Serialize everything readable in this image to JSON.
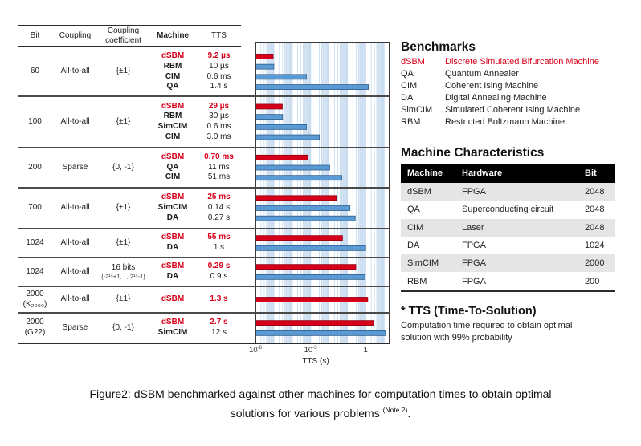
{
  "colors": {
    "dsbm": "#d7001a",
    "dsbm_border": "#8e0010",
    "other": "#5b9bd5",
    "other_border": "#2f5b8a",
    "grid_line": "#c6dbef",
    "grid_band": "#dbe8f5"
  },
  "left_table": {
    "headers": {
      "bit": "Bit",
      "coupling": "Coupling",
      "coefficient": [
        "Coupling",
        "coefficient"
      ],
      "machine": "Machine",
      "tts": "TTS"
    },
    "rows": [
      {
        "bit": [
          "60"
        ],
        "coupling": "All-to-all",
        "coefficient": [
          "{±1}"
        ],
        "entries": [
          {
            "machine": "dSBM",
            "tts": "9.2 µs",
            "highlight": true
          },
          {
            "machine": "RBM",
            "tts": "10 µs",
            "highlight": false
          },
          {
            "machine": "CIM",
            "tts": "0.6 ms",
            "highlight": false
          },
          {
            "machine": "QA",
            "tts": "1.4 s",
            "highlight": false
          }
        ]
      },
      {
        "bit": [
          "100"
        ],
        "coupling": "All-to-all",
        "coefficient": [
          "{±1}"
        ],
        "entries": [
          {
            "machine": "dSBM",
            "tts": "29 µs",
            "highlight": true
          },
          {
            "machine": "RBM",
            "tts": "30 µs",
            "highlight": false
          },
          {
            "machine": "SimCIM",
            "tts": "0.6 ms",
            "highlight": false
          },
          {
            "machine": "CIM",
            "tts": "3.0 ms",
            "highlight": false
          }
        ]
      },
      {
        "bit": [
          "200"
        ],
        "coupling": "Sparse",
        "coefficient": [
          "{0, -1}"
        ],
        "entries": [
          {
            "machine": "dSBM",
            "tts": "0.70 ms",
            "highlight": true
          },
          {
            "machine": "QA",
            "tts": "11 ms",
            "highlight": false
          },
          {
            "machine": "CIM",
            "tts": "51 ms",
            "highlight": false
          }
        ]
      },
      {
        "bit": [
          "700"
        ],
        "coupling": "All-to-all",
        "coefficient": [
          "{±1}"
        ],
        "entries": [
          {
            "machine": "dSBM",
            "tts": "25 ms",
            "highlight": true
          },
          {
            "machine": "SimCIM",
            "tts": "0.14 s",
            "highlight": false
          },
          {
            "machine": "DA",
            "tts": "0.27 s",
            "highlight": false
          }
        ]
      },
      {
        "bit": [
          "1024"
        ],
        "coupling": "All-to-all",
        "coefficient": [
          "{±1}"
        ],
        "entries": [
          {
            "machine": "dSBM",
            "tts": "55 ms",
            "highlight": true
          },
          {
            "machine": "DA",
            "tts": "1 s",
            "highlight": false
          }
        ]
      },
      {
        "bit": [
          "1024"
        ],
        "coupling": "All-to-all",
        "coefficient": [
          "16 bits",
          "{-2¹⁵+1,..., 2¹⁵-1}"
        ],
        "entries": [
          {
            "machine": "dSBM",
            "tts": "0.29 s",
            "highlight": true
          },
          {
            "machine": "DA",
            "tts": "0.9 s",
            "highlight": false
          }
        ]
      },
      {
        "bit": [
          "2000",
          "(K₂₀₀₀)"
        ],
        "coupling": "All-to-all",
        "coefficient": [
          "{±1}"
        ],
        "entries": [
          {
            "machine": "dSBM",
            "tts": "1.3 s",
            "highlight": true
          }
        ]
      },
      {
        "bit": [
          "2000",
          "(G22)"
        ],
        "coupling": "Sparse",
        "coefficient": [
          "{0, -1}"
        ],
        "entries": [
          {
            "machine": "dSBM",
            "tts": "2.7 s",
            "highlight": true
          },
          {
            "machine": "SimCIM",
            "tts": "12 s",
            "highlight": false
          }
        ]
      }
    ]
  },
  "chart_data": {
    "type": "bar",
    "orientation": "horizontal",
    "xscale": "log",
    "xlabel": "TTS (s)",
    "ylabel": "",
    "xlim": [
      1e-06,
      20
    ],
    "grid": true,
    "xticks": [
      {
        "value": 1e-06,
        "base": "10",
        "exp": "-6"
      },
      {
        "value": 0.001,
        "base": "10",
        "exp": "-3"
      },
      {
        "value": 1,
        "base": "1",
        "exp": ""
      }
    ],
    "groups": [
      {
        "bit": "60",
        "bars": [
          {
            "machine": "dSBM",
            "value": 9.2e-06
          },
          {
            "machine": "RBM",
            "value": 1e-05
          },
          {
            "machine": "CIM",
            "value": 0.0006
          },
          {
            "machine": "QA",
            "value": 1.4
          }
        ]
      },
      {
        "bit": "100",
        "bars": [
          {
            "machine": "dSBM",
            "value": 2.9e-05
          },
          {
            "machine": "RBM",
            "value": 3e-05
          },
          {
            "machine": "SimCIM",
            "value": 0.0006
          },
          {
            "machine": "CIM",
            "value": 0.003
          }
        ]
      },
      {
        "bit": "200",
        "bars": [
          {
            "machine": "dSBM",
            "value": 0.0007
          },
          {
            "machine": "QA",
            "value": 0.011
          },
          {
            "machine": "CIM",
            "value": 0.051
          }
        ]
      },
      {
        "bit": "700",
        "bars": [
          {
            "machine": "dSBM",
            "value": 0.025
          },
          {
            "machine": "SimCIM",
            "value": 0.14
          },
          {
            "machine": "DA",
            "value": 0.27
          }
        ]
      },
      {
        "bit": "1024",
        "bars": [
          {
            "machine": "dSBM",
            "value": 0.055
          },
          {
            "machine": "DA",
            "value": 1
          }
        ]
      },
      {
        "bit": "1024 (16 bits)",
        "bars": [
          {
            "machine": "dSBM",
            "value": 0.29
          },
          {
            "machine": "DA",
            "value": 0.9
          }
        ]
      },
      {
        "bit": "2000 (K2000)",
        "bars": [
          {
            "machine": "dSBM",
            "value": 1.3
          }
        ]
      },
      {
        "bit": "2000 (G22)",
        "bars": [
          {
            "machine": "dSBM",
            "value": 2.7
          },
          {
            "machine": "SimCIM",
            "value": 12
          }
        ]
      }
    ]
  },
  "benchmarks": {
    "title": "Benchmarks",
    "items": [
      {
        "abbr": "dSBM",
        "name": "Discrete Simulated Bifurcation Machine",
        "highlight": true
      },
      {
        "abbr": "QA",
        "name": "Quantum Annealer",
        "highlight": false
      },
      {
        "abbr": "CIM",
        "name": "Coherent Ising Machine",
        "highlight": false
      },
      {
        "abbr": "DA",
        "name": "Digital Annealing Machine",
        "highlight": false
      },
      {
        "abbr": "SimCIM",
        "name": "Simulated Coherent Ising Machine",
        "highlight": false
      },
      {
        "abbr": "RBM",
        "name": "Restricted Boltzmann Machine",
        "highlight": false
      }
    ]
  },
  "machine_characteristics": {
    "title": "Machine Characteristics",
    "headers": [
      "Machine",
      "Hardware",
      "Bit"
    ],
    "rows": [
      [
        "dSBM",
        "FPGA",
        "2048"
      ],
      [
        "QA",
        "Superconducting circuit",
        "2048"
      ],
      [
        "CIM",
        "Laser",
        "2048"
      ],
      [
        "DA",
        "FPGA",
        "1024"
      ],
      [
        "SimCIM",
        "FPGA",
        "2000"
      ],
      [
        "RBM",
        "FPGA",
        "200"
      ]
    ]
  },
  "tts_note": {
    "title": "* TTS (Time-To-Solution)",
    "lines": [
      "Computation time required to obtain optimal",
      "solution with 99% probability"
    ]
  },
  "caption": {
    "line1": "Figure2: dSBM benchmarked against other machines for computation times to obtain optimal",
    "line2": "solutions for various problems ",
    "note": "(Note 2)",
    "end": "."
  }
}
